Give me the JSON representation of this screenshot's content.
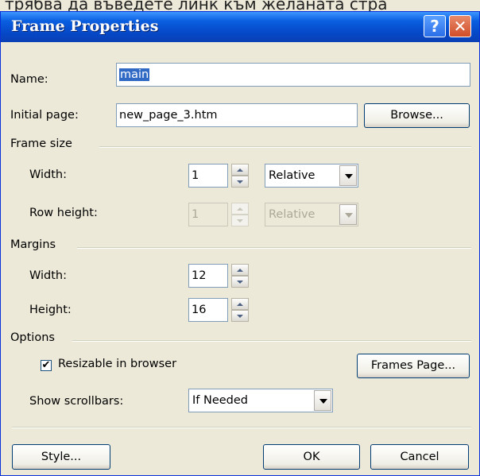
{
  "background_text": "трябва да въведете линк към желаната стра",
  "window": {
    "title": "Frame Properties",
    "help_label": "?",
    "close_label": "✕"
  },
  "name": {
    "label": "Name:",
    "value": "main"
  },
  "initial_page": {
    "label": "Initial page:",
    "value": "new_page_3.htm",
    "browse_label": "Browse..."
  },
  "frame_size": {
    "group_label": "Frame size",
    "width_label": "Width:",
    "width_value": "1",
    "width_unit": "Relative",
    "row_height_label": "Row height:",
    "row_height_value": "1",
    "row_height_unit": "Relative"
  },
  "margins": {
    "group_label": "Margins",
    "width_label": "Width:",
    "width_value": "12",
    "height_label": "Height:",
    "height_value": "16"
  },
  "options": {
    "group_label": "Options",
    "resizable_label": "Resizable in browser",
    "resizable_checked": true,
    "check_glyph": "✔",
    "frames_page_label": "Frames Page...",
    "scrollbars_label": "Show scrollbars:",
    "scrollbars_value": "If Needed"
  },
  "footer": {
    "style_label": "Style...",
    "ok_label": "OK",
    "cancel_label": "Cancel"
  },
  "colors": {
    "title_bar": "#0a5fe0",
    "dialog_bg": "#ece9d8",
    "selection": "#316ac5"
  }
}
